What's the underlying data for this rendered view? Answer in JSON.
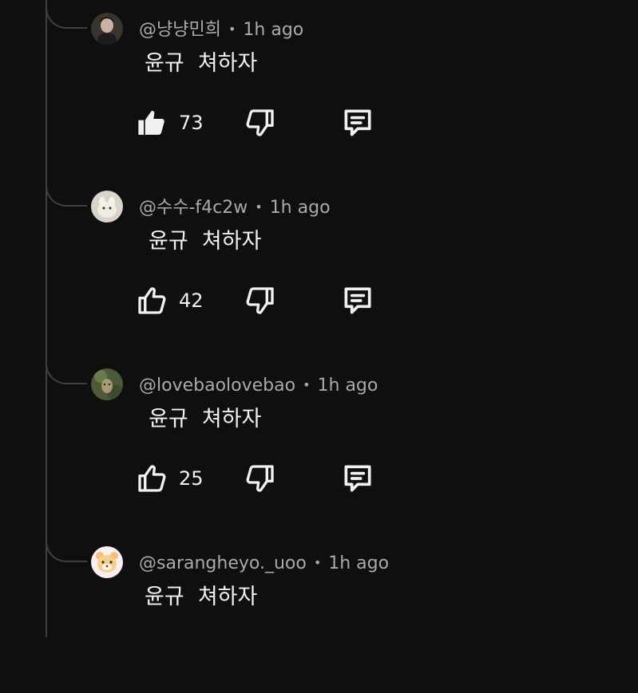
{
  "comments": [
    {
      "author": "@냥냥민희",
      "time": "1h ago",
      "text": "윤규  쳐하자",
      "likes": "73",
      "liked": true
    },
    {
      "author": "@수수-f4c2w",
      "time": "1h ago",
      "text": "윤규  쳐하자",
      "likes": "42",
      "liked": false
    },
    {
      "author": "@lovebaolovebao",
      "time": "1h ago",
      "text": "윤규  쳐하자",
      "likes": "25",
      "liked": false
    },
    {
      "author": "@sarangheyo._uoo",
      "time": "1h ago",
      "text": "윤규  쳐하자"
    }
  ],
  "colors": {
    "background": "#0f0f0f",
    "thread_line": "#3f3f3f",
    "meta_text": "#aaaaaa",
    "body_text": "#f1f1f1"
  },
  "icons": [
    "thumbs-up-icon",
    "thumbs-down-icon",
    "reply-icon"
  ]
}
